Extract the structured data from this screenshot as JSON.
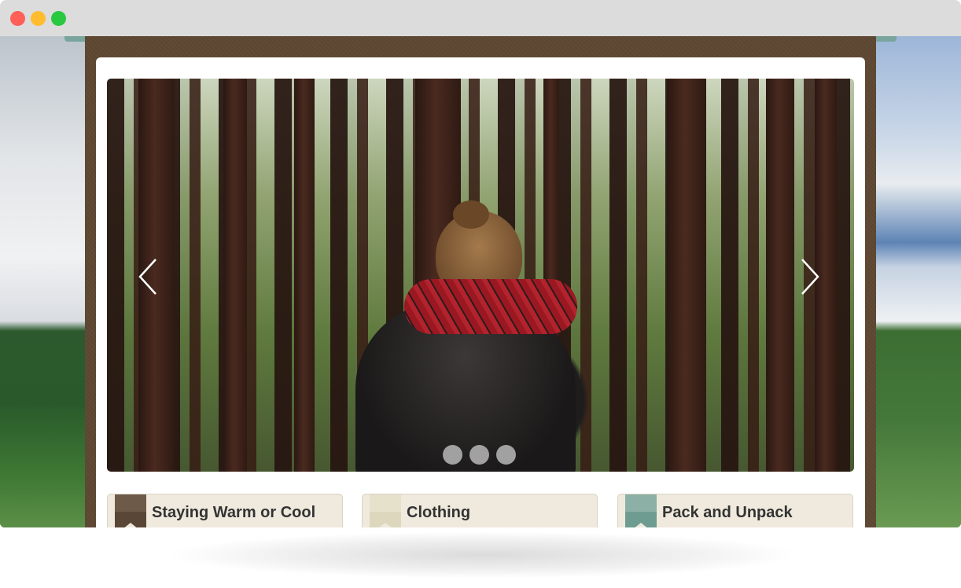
{
  "window": {
    "controls": [
      {
        "name": "close",
        "color": "#fe5f57"
      },
      {
        "name": "minimize",
        "color": "#febc2e"
      },
      {
        "name": "maximize",
        "color": "#28c840"
      }
    ]
  },
  "slider": {
    "image": "forest-hero-photo",
    "prev_icon": "chevron-left-icon",
    "next_icon": "chevron-right-icon",
    "dots": 3,
    "active_dot": 0
  },
  "cards": [
    {
      "label": "Staying Warm or Cool",
      "flag_color": "#6e5a48",
      "flag_accent": "#5a4636"
    },
    {
      "label": "Clothing",
      "flag_color": "#e6e1cb",
      "flag_accent": "#ddd7bd"
    },
    {
      "label": "Pack and Unpack",
      "flag_color": "#8cb0a6",
      "flag_accent": "#6f9c90"
    }
  ],
  "colors": {
    "frame": "#5b4632",
    "card_bg": "#efeadd",
    "panel_bg": "#ffffff",
    "ribbon": "#7aa59d"
  }
}
